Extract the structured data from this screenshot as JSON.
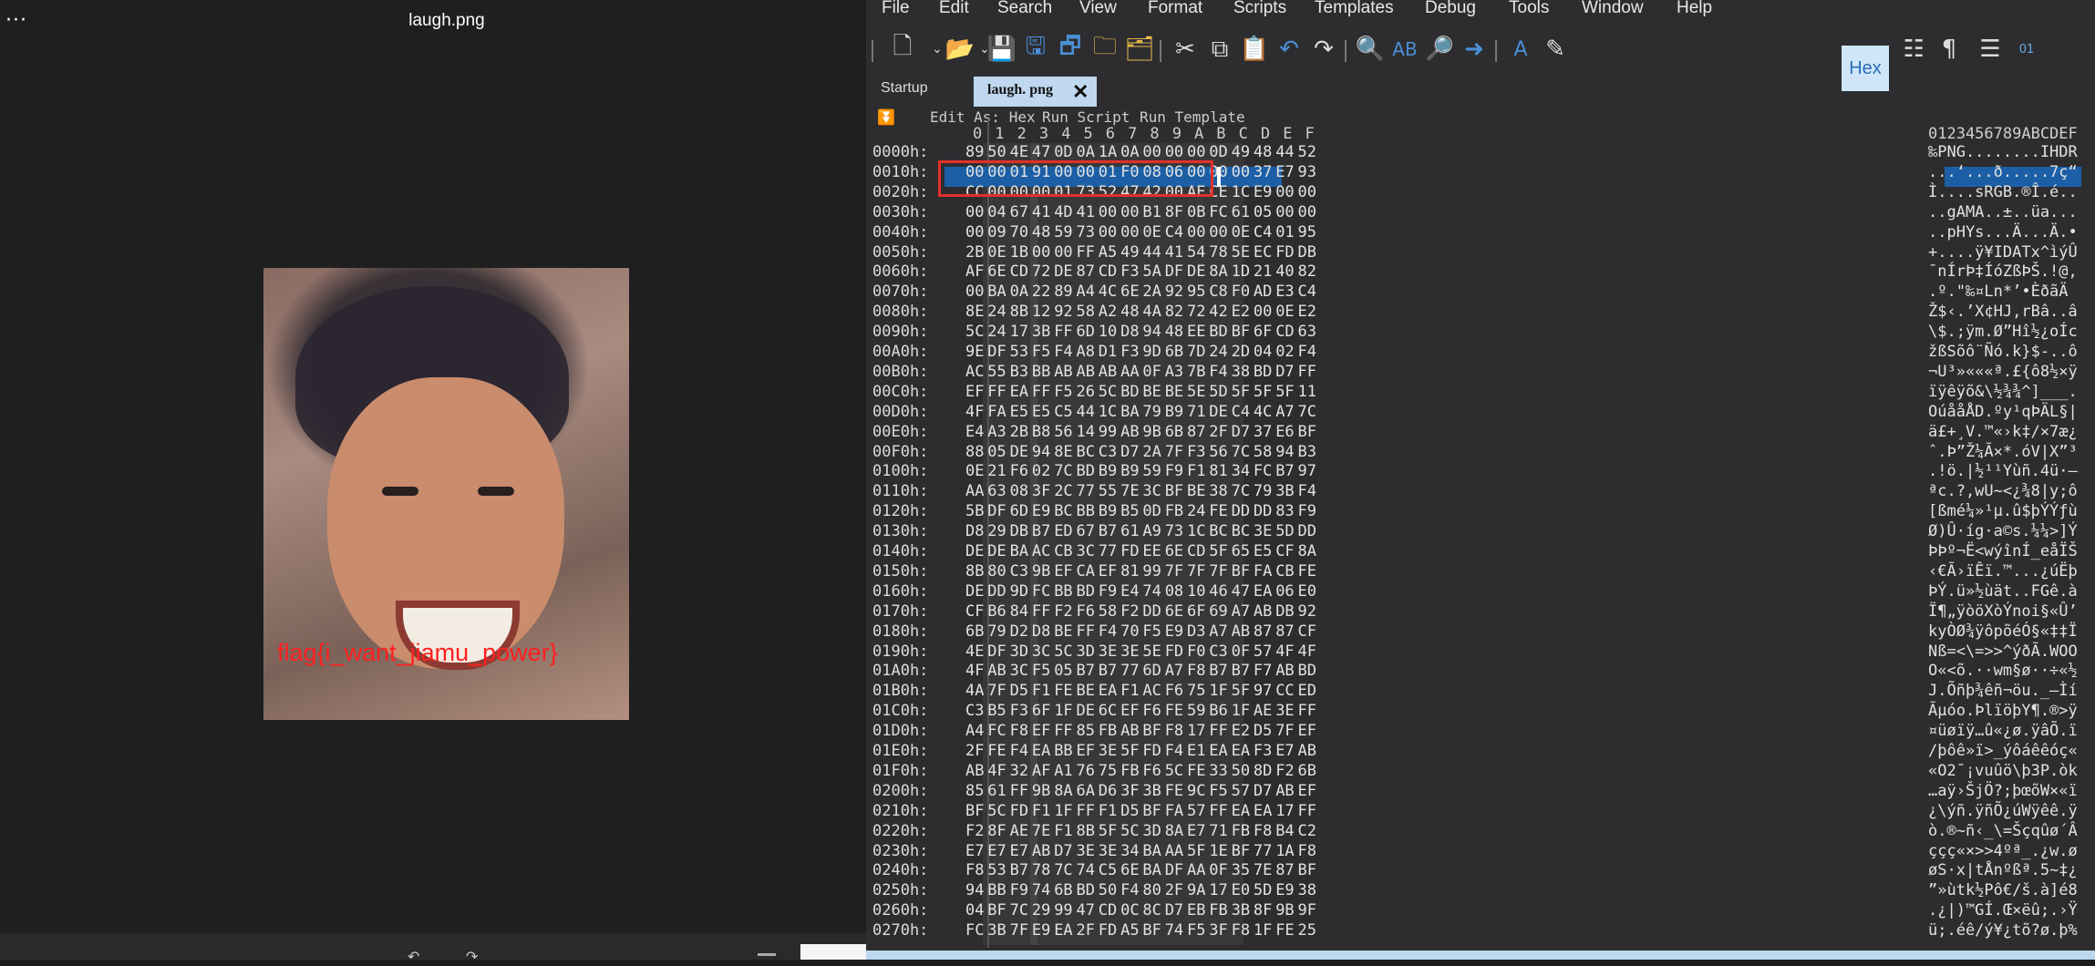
{
  "viewer": {
    "menu_glyph": "···",
    "title": "laugh.png",
    "flag_text": "flag{i_want_jiamu_power}",
    "rotate_left": "↶",
    "rotate_right": "↷"
  },
  "editor": {
    "menus": [
      "File",
      "Edit",
      "Search",
      "View",
      "Format",
      "Scripts",
      "Templates",
      "Debug",
      "Tools",
      "Window",
      "Help"
    ],
    "hex_toggle_label": "Hex",
    "tabs": {
      "startup": "Startup",
      "active": "laugh. png"
    },
    "subbar": {
      "edit_as": "Edit As: Hex",
      "run_script": "Run Script",
      "run_template": "Run Template"
    },
    "col_headers": [
      "0",
      "1",
      "2",
      "3",
      "4",
      "5",
      "6",
      "7",
      "8",
      "9",
      "A",
      "B",
      "C",
      "D",
      "E",
      "F"
    ],
    "ascii_header": "0123456789ABCDEF",
    "rows": [
      {
        "addr": "0000h:",
        "hex": "89 50 4E 47 0D 0A 1A 0A 00 00 00 0D 49 48 44 52",
        "ascii": "‰PNG........IHDR"
      },
      {
        "addr": "0010h:",
        "hex": "00 00 01 91 00 00 01 F0 08 06 00 00 00 37 E7 93",
        "ascii": "...‘...ð.....7ç“"
      },
      {
        "addr": "0020h:",
        "hex": "CC 00 00 00 01 73 52 47 42 00 AE CE 1C E9 00 00",
        "ascii": "Ì....sRGB.®Î.é.."
      },
      {
        "addr": "0030h:",
        "hex": "00 04 67 41 4D 41 00 00 B1 8F 0B FC 61 05 00 00",
        "ascii": "..gAMA..±..üa..."
      },
      {
        "addr": "0040h:",
        "hex": "00 09 70 48 59 73 00 00 0E C4 00 00 0E C4 01 95",
        "ascii": "..pHYs...Ä...Ä.•"
      },
      {
        "addr": "0050h:",
        "hex": "2B 0E 1B 00 00 FF A5 49 44 41 54 78 5E EC FD DB",
        "ascii": "+....ÿ¥IDATx^ìýÛ"
      },
      {
        "addr": "0060h:",
        "hex": "AF 6E CD 72 DE 87 CD F3 5A DF DE 8A 1D 21 40 82",
        "ascii": "¯nÍrÞ‡ÍóZßÞŠ.!@‚"
      },
      {
        "addr": "0070h:",
        "hex": "00 BA 0A 22 89 A4 4C 6E 2A 92 95 C8 F0 AD E3 C4",
        "ascii": ".º.\"‰¤Ln*’•Èð­ãÄ"
      },
      {
        "addr": "0080h:",
        "hex": "8E 24 8B 12 92 58 A2 48 4A 82 72 42 E2 00 0E E2",
        "ascii": "Ž$‹.’X¢HJ‚rBâ..â"
      },
      {
        "addr": "0090h:",
        "hex": "5C 24 17 3B FF 6D 10 D8 94 48 EE BD BF 6F CD 63",
        "ascii": "\\$.;ÿm.Ø”Hî½¿oÍc"
      },
      {
        "addr": "00A0h:",
        "hex": "9E DF 53 F5 F4 A8 D1 F3 9D 6B 7D 24 2D 04 02 F4",
        "ascii": "žßSõô¨Ñó.k}$-..ô"
      },
      {
        "addr": "00B0h:",
        "hex": "AC 55 B3 BB AB AB AB AA 0F A3 7B F4 38 BD D7 FF",
        "ascii": "¬U³»«««ª.£{ô8½×ÿ"
      },
      {
        "addr": "00C0h:",
        "hex": "EF FF EA FF F5 26 5C BD BE BE 5E 5D 5F 5F 5F 11",
        "ascii": "ïÿêÿõ&\\½¾¾^]___."
      },
      {
        "addr": "00D0h:",
        "hex": "4F FA E5 E5 C5 44 1C BA 79 B9 71 DE C4 4C A7 7C",
        "ascii": "OúååÅD.ºy¹qÞÄL§|"
      },
      {
        "addr": "00E0h:",
        "hex": "E4 A3 2B B8 56 14 99 AB 9B 6B 87 2F D7 37 E6 BF",
        "ascii": "ä£+¸V.™«›k‡/×7æ¿"
      },
      {
        "addr": "00F0h:",
        "hex": "88 05 DE 94 8E BC C3 D7 2A 7F F3 56 7C 58 94 B3",
        "ascii": "ˆ.Þ”Ž¼Ã×*.óV|X”³"
      },
      {
        "addr": "0100h:",
        "hex": "0E 21 F6 02 7C BD B9 B9 59 F9 F1 81 34 FC B7 97",
        "ascii": ".!ö.|½¹¹Yùñ.4ü·—"
      },
      {
        "addr": "0110h:",
        "hex": "AA 63 08 3F 2C 77 55 7E 3C BF BE 38 7C 79 3B F4",
        "ascii": "ªc.?,wU~<¿¾8|y;ô"
      },
      {
        "addr": "0120h:",
        "hex": "5B DF 6D E9 BC BB B9 B5 0D FB 24 FE DD DD 83 F9",
        "ascii": "[ßmé¼»¹µ.û$þÝÝƒù"
      },
      {
        "addr": "0130h:",
        "hex": "D8 29 DB B7 ED 67 B7 61 A9 73 1C BC BC 3E 5D DD",
        "ascii": "Ø)Û·íg·a©s.¼¼>]Ý"
      },
      {
        "addr": "0140h:",
        "hex": "DE DE BA AC CB 3C 77 FD EE 6E CD 5F 65 E5 CF 8A",
        "ascii": "ÞÞº¬Ë<wýînÍ_eåÏŠ"
      },
      {
        "addr": "0150h:",
        "hex": "8B 80 C3 9B EF CA EF 81 99 7F 7F 7F BF FA CB FE",
        "ascii": "‹€Ã›ïÊï.™...¿úËþ"
      },
      {
        "addr": "0160h:",
        "hex": "DE DD 9D FC BB BD F9 E4 74 08 10 46 47 EA 06 E0",
        "ascii": "ÞÝ.ü»½ùät..FGê.à"
      },
      {
        "addr": "0170h:",
        "hex": "CF B6 84 FF F2 F6 58 F2 DD 6E 6F 69 A7 AB DB 92",
        "ascii": "Ï¶„ÿòöXòÝnoi§«Û’"
      },
      {
        "addr": "0180h:",
        "hex": "6B 79 D2 D8 BE FF F4 70 F5 E9 D3 A7 AB 87 87 CF",
        "ascii": "kyÒØ¾ÿôpõéÓ§«‡‡Ï"
      },
      {
        "addr": "0190h:",
        "hex": "4E DF 3D 3C 5C 3D 3E 3E 5E FD F0 C3 0F 57 4F 4F",
        "ascii": "Nß=<\\=>>^ýðÃ.WOO"
      },
      {
        "addr": "01A0h:",
        "hex": "4F AB 3C F5 05 B7 B7 77 6D A7 F8 B7 B7 F7 AB BD",
        "ascii": "O«<õ.··wm§ø··÷«½"
      },
      {
        "addr": "01B0h:",
        "hex": "4A 7F D5 F1 FE BE EA F1 AC F6 75 1F 5F 97 CC ED",
        "ascii": "J.Õñþ¾êñ¬öu._—Ìí"
      },
      {
        "addr": "01C0h:",
        "hex": "C3 B5 F3 6F 1F DE 6C EF F6 FE 59 B6 1F AE 3E FF",
        "ascii": "Ãµóo.ÞlïöþY¶.®>ÿ"
      },
      {
        "addr": "01D0h:",
        "hex": "A4 FC F8 EF FF 85 FB AB BF F8 17 FF E2 D5 7F EF",
        "ascii": "¤üøïÿ…û«¿ø.ÿâÕ.ï"
      },
      {
        "addr": "01E0h:",
        "hex": "2F FE F4 EA BB EF 3E 5F FD F4 E1 EA EA F3 E7 AB",
        "ascii": "/þôê»ï>_ýôáêêóç«"
      },
      {
        "addr": "01F0h:",
        "hex": "AB 4F 32 AF A1 76 75 FB F6 5C FE 33 50 8D F2 6B",
        "ascii": "«O2¯¡vuûö\\þ3P.òk"
      },
      {
        "addr": "0200h:",
        "hex": "85 61 FF 9B 8A 6A D6 3F 3B FE 9C F5 57 D7 AB EF",
        "ascii": "…aÿ›ŠjÖ?;þœõW×«ï"
      },
      {
        "addr": "0210h:",
        "hex": "BF 5C FD F1 1F FF F1 D5 BF FA 57 FF EA EA 17 FF",
        "ascii": "¿\\ýñ.ÿñÕ¿úWÿêê.ÿ"
      },
      {
        "addr": "0220h:",
        "hex": "F2 8F AE 7E F1 8B 5F 5C 3D 8A E7 71 FB F8 B4 C2",
        "ascii": "ò.®~ñ‹_\\=Šçqûø´Â"
      },
      {
        "addr": "0230h:",
        "hex": "E7 E7 E7 AB D7 3E 3E 34 BA AA 5F 1E BF 77 1A F8",
        "ascii": "ççç«×>>4ºª_.¿w.ø"
      },
      {
        "addr": "0240h:",
        "hex": "F8 53 B7 78 7C 74 C5 6E BA DF AA 0F 35 7E 87 BF",
        "ascii": "øS·x|tÅnºßª.5~‡¿"
      },
      {
        "addr": "0250h:",
        "hex": "94 BB F9 74 6B BD 50 F4 80 2F 9A 17 E0 5D E9 38",
        "ascii": "”»ùtk½Pô€/š.à]é8"
      },
      {
        "addr": "0260h:",
        "hex": "04 BF 7C 29 99 47 CD 0C 8C D7 EB FB 3B 8F 9B 9F",
        "ascii": ".¿|)™GÍ.Œ×ëû;.›Ÿ"
      },
      {
        "addr": "0270h:",
        "hex": "FC 3B 7F E9 EA 2F FD A5 BF 74 F5 3F F8 1F FE 25",
        "ascii": "ü;.éê/ý¥¿tõ?ø.þ%"
      }
    ]
  }
}
